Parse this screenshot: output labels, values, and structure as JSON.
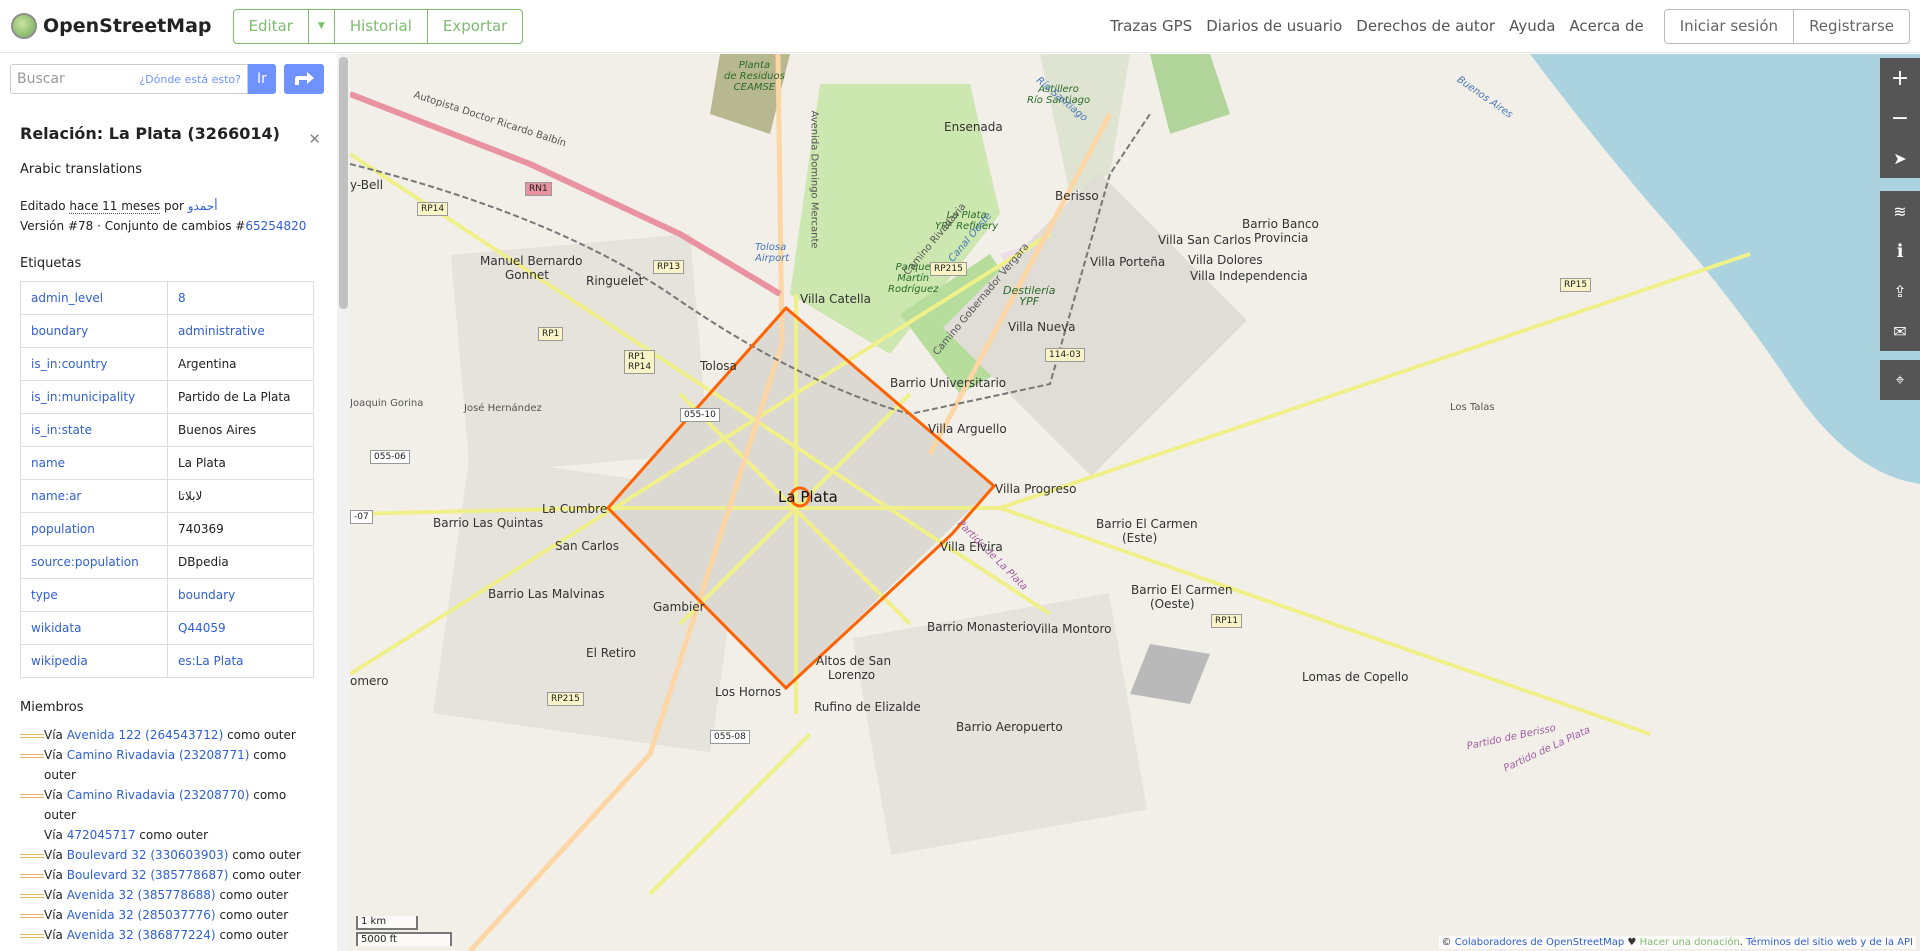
{
  "header": {
    "logo_text": "OpenStreetMap",
    "edit": "Editar",
    "history": "Historial",
    "export": "Exportar",
    "nav": [
      "Trazas GPS",
      "Diarios de usuario",
      "Derechos de autor",
      "Ayuda",
      "Acerca de"
    ],
    "login": "Iniciar sesión",
    "signup": "Registrarse"
  },
  "search": {
    "placeholder": "Buscar",
    "where": "¿Dónde está esto?",
    "go": "Ir"
  },
  "panel": {
    "title": "Relación: La Plata (3266014)",
    "description": "Arabic translations",
    "edited_prefix": "Editado",
    "edited_time": "hace 11 meses",
    "edited_by": "por",
    "user": "أحمدو",
    "version": "Versión #78 · Conjunto de cambios #",
    "changeset": "65254820",
    "tags_heading": "Etiquetas",
    "tags": [
      {
        "k": "admin_level",
        "v": "8",
        "link": true
      },
      {
        "k": "boundary",
        "v": "administrative",
        "link": true
      },
      {
        "k": "is_in:country",
        "v": "Argentina",
        "link": false
      },
      {
        "k": "is_in:municipality",
        "v": "Partido de La Plata",
        "link": false
      },
      {
        "k": "is_in:state",
        "v": "Buenos Aires",
        "link": false
      },
      {
        "k": "name",
        "v": "La Plata",
        "link": false
      },
      {
        "k": "name:ar",
        "v": "لابلاتا",
        "link": false
      },
      {
        "k": "population",
        "v": "740369",
        "link": false
      },
      {
        "k": "source:population",
        "v": "DBpedia",
        "link": false
      },
      {
        "k": "type",
        "v": "boundary",
        "link": true
      },
      {
        "k": "wikidata",
        "v": "Q44059",
        "link": true
      },
      {
        "k": "wikipedia",
        "v": "es:La Plata",
        "link": true
      }
    ],
    "members_heading": "Miembros",
    "members": [
      {
        "pre": "Vía",
        "link": "Avenida 122 (264543712)",
        "post": "como outer",
        "sw": true
      },
      {
        "pre": "Vía",
        "link": "Camino Rivadavia (23208771)",
        "post": "como outer",
        "sw": true
      },
      {
        "pre": "Vía",
        "link": "Camino Rivadavia (23208770)",
        "post": "como outer",
        "sw": true
      },
      {
        "pre": "Vía",
        "link": "472045717",
        "post": "como outer",
        "sw": false
      },
      {
        "pre": "Vía",
        "link": "Boulevard 32 (330603903)",
        "post": "como outer",
        "sw": true
      },
      {
        "pre": "Vía",
        "link": "Boulevard 32 (385778687)",
        "post": "como outer",
        "sw": true
      },
      {
        "pre": "Vía",
        "link": "Avenida 32 (385778688)",
        "post": "como outer",
        "sw": true
      },
      {
        "pre": "Vía",
        "link": "Avenida 32 (285037776)",
        "post": "como outer",
        "sw": true
      },
      {
        "pre": "Vía",
        "link": "Avenida 32 (386877224)",
        "post": "como outer",
        "sw": true
      }
    ]
  },
  "map": {
    "scale_km": "1 km",
    "scale_ft": "5000 ft",
    "attribution": {
      "copy": "©",
      "contrib": "Colaboradores de OpenStreetMap",
      "heart": "♥",
      "donate": "Hacer una donación",
      "terms": "Términos del sitio web y de la API"
    },
    "controls": [
      "zoom-in",
      "zoom-out",
      "locate",
      "layers",
      "info",
      "share",
      "note",
      "query"
    ],
    "places": {
      "la_plata": "La Plata",
      "ensenada": "Ensenada",
      "berisso": "Berisso",
      "tolosa": "Tolosa",
      "ringuelet": "Ringuelet",
      "manuel_bernardo": "Manuel Bernardo",
      "gonnet": "Gonnet",
      "villa_catella": "Villa Catella",
      "villa_nueva": "Villa Nueva",
      "barrio_universitario": "Barrio Universitario",
      "villa_arguello": "Villa Arguello",
      "villa_progreso": "Villa Progreso",
      "villa_elvira": "Villa Elvira",
      "la_cumbre": "La Cumbre",
      "san_carlos": "San Carlos",
      "barrio_las_quintas": "Barrio Las Quintas",
      "jose_hernandez": "José Hernández",
      "joaquin_gorina": "Joaquin Gorina",
      "barrio_las_malvinas": "Barrio Las Malvinas",
      "gambier": "Gambier",
      "el_retiro": "El Retiro",
      "los_hornos": "Los Hornos",
      "altos1": "Altos de San",
      "altos2": "Lorenzo",
      "rufino": "Rufino de Elizalde",
      "barrio_monasterio": "Barrio Monasterio",
      "villa_montoro": "Villa Montoro",
      "barrio_aeropuerto": "Barrio Aeropuerto",
      "barrio_el_carmen_este1": "Barrio El Carmen",
      "barrio_el_carmen_este2": "(Este)",
      "barrio_el_carmen_oeste1": "Barrio El Carmen",
      "barrio_el_carmen_oeste2": "(Oeste)",
      "lomas_copello": "Lomas de Copello",
      "villa_san_carlos": "Villa San Carlos",
      "villa_dolores": "Villa Dolores",
      "villa_portena": "Villa Porteña",
      "villa_independencia": "Villa Independencia",
      "barrio_banco1": "Barrio Banco",
      "barrio_banco2": "Provincia",
      "los_talas": "Los Talas",
      "bell": "y-Bell",
      "omero": "omero"
    },
    "areas": {
      "planta1": "Planta",
      "planta2": "de Residuos",
      "planta3": "CEAMSE",
      "astillero1": "Astillero",
      "astillero2": "Río Santiago",
      "refinery1": "La Plata",
      "refinery2": "YPF Refinery",
      "parque1": "Parque",
      "parque2": "Martín",
      "parque3": "Rodríguez",
      "destileria1": "Destilería",
      "destileria2": "YPF",
      "tolosa_air1": "Tolosa",
      "tolosa_air2": "Airport"
    },
    "water": {
      "buenos_aires": "Buenos Aires",
      "rio": "Río Santiago",
      "canal": "Canal Oeste"
    },
    "district": [
      "Partido de La Plata",
      "Partido de Berisso",
      "Partido de La Plata"
    ],
    "roads": {
      "rn1": "RN1",
      "rp14": "RP14",
      "rp13": "RP13",
      "rp1": "RP1",
      "rp1b": "RP1\nRP14",
      "rp215": "RP215",
      "rp215b": "RP215",
      "rp15": "RP15",
      "rp11": "RP11",
      "r11403": "114-03",
      "r05510": "055-10",
      "r05506": "055-06",
      "r05508": "055-08",
      "r07": "-07"
    },
    "streets": {
      "autopista": "Autopista Doctor Ricardo Balbín",
      "dominguez": "Avenida Domingo Mercante",
      "rivadavia": "Camino Rivadavia",
      "gobernador": "Camino Gobernador Vergara"
    }
  }
}
